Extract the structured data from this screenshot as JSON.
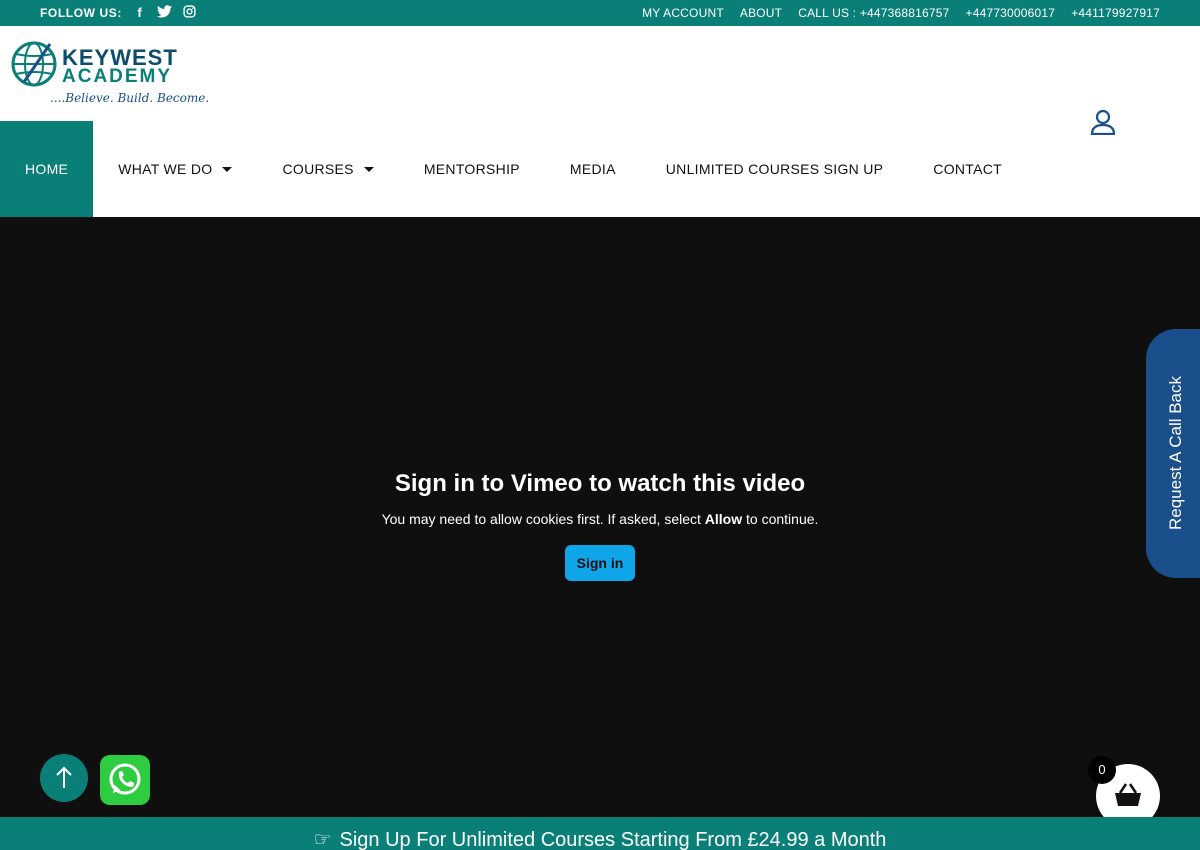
{
  "topbar": {
    "follow_label": "FOLLOW US:",
    "social": [
      "facebook-icon",
      "twitter-icon",
      "instagram-icon"
    ],
    "links": [
      "MY ACCOUNT",
      "ABOUT",
      "CALL US : +447368816757",
      "+447730006017",
      "+441179927917"
    ]
  },
  "logo": {
    "line1": "KEYWEST",
    "line2": "ACADEMY",
    "tagline": "....Believe. Build. Become."
  },
  "nav": {
    "items": [
      {
        "label": "HOME",
        "active": true,
        "dropdown": false
      },
      {
        "label": "WHAT WE DO",
        "active": false,
        "dropdown": true
      },
      {
        "label": "COURSES",
        "active": false,
        "dropdown": true
      },
      {
        "label": "MENTORSHIP",
        "active": false,
        "dropdown": false
      },
      {
        "label": "MEDIA",
        "active": false,
        "dropdown": false
      },
      {
        "label": "UNLIMITED COURSES SIGN UP",
        "active": false,
        "dropdown": false
      },
      {
        "label": "CONTACT",
        "active": false,
        "dropdown": false
      }
    ]
  },
  "video": {
    "title": "Sign in to Vimeo to watch this video",
    "subtitle_before": "You may need to allow cookies first. If asked, select ",
    "subtitle_bold": "Allow",
    "subtitle_after": " to continue.",
    "button": "Sign in"
  },
  "callback": {
    "label": "Request A Call Back"
  },
  "cart": {
    "count": "0"
  },
  "banner": {
    "text": "Sign Up For Unlimited Courses Starting From £24.99 a Month"
  },
  "colors": {
    "teal": "#0a7f78",
    "navy": "#1a4f8b",
    "vimeo_blue": "#0ea5e9",
    "whatsapp": "#2ecc40"
  }
}
